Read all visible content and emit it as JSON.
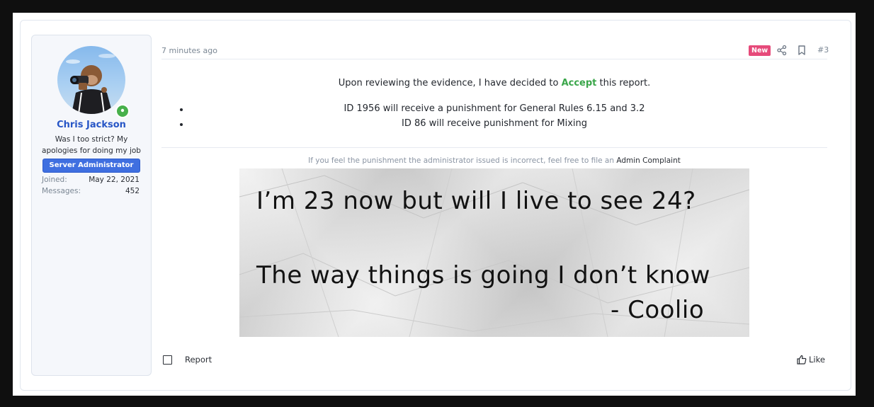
{
  "user": {
    "name": "Chris Jackson",
    "title": "Was I too strict? My apologies for doing my job",
    "banner": "Server Administrator",
    "stats": [
      {
        "label": "Joined:",
        "value": "May 22, 2021"
      },
      {
        "label": "Messages:",
        "value": "452"
      }
    ]
  },
  "post": {
    "date": "7 minutes ago",
    "badge": "New",
    "number": "#3",
    "icons": [
      "share-icon",
      "bookmark-icon"
    ],
    "intro_before": "Upon reviewing the evidence, I have decided to ",
    "intro_accent": "Accept",
    "intro_after": " this report.",
    "bullets": [
      "ID 1956 will receive a punishment for General Rules 6.15 and 3.2",
      "ID 86 will receive punishment for Mixing"
    ],
    "notice_text": "If you feel the punishment the administrator issued is incorrect, feel free to file an ",
    "notice_link": "Admin Complaint",
    "image_lines": [
      "I’m 23 now but will I live to see 24?",
      "The way things is going I don’t know",
      "- Coolio"
    ]
  },
  "footer": {
    "report_label": "Report",
    "like_label": "Like"
  },
  "colors": {
    "accent_green": "#3aa64a",
    "username_blue": "#2756c6",
    "banner_blue": "#3f6fe0",
    "new_badge": "#e64a7a"
  }
}
